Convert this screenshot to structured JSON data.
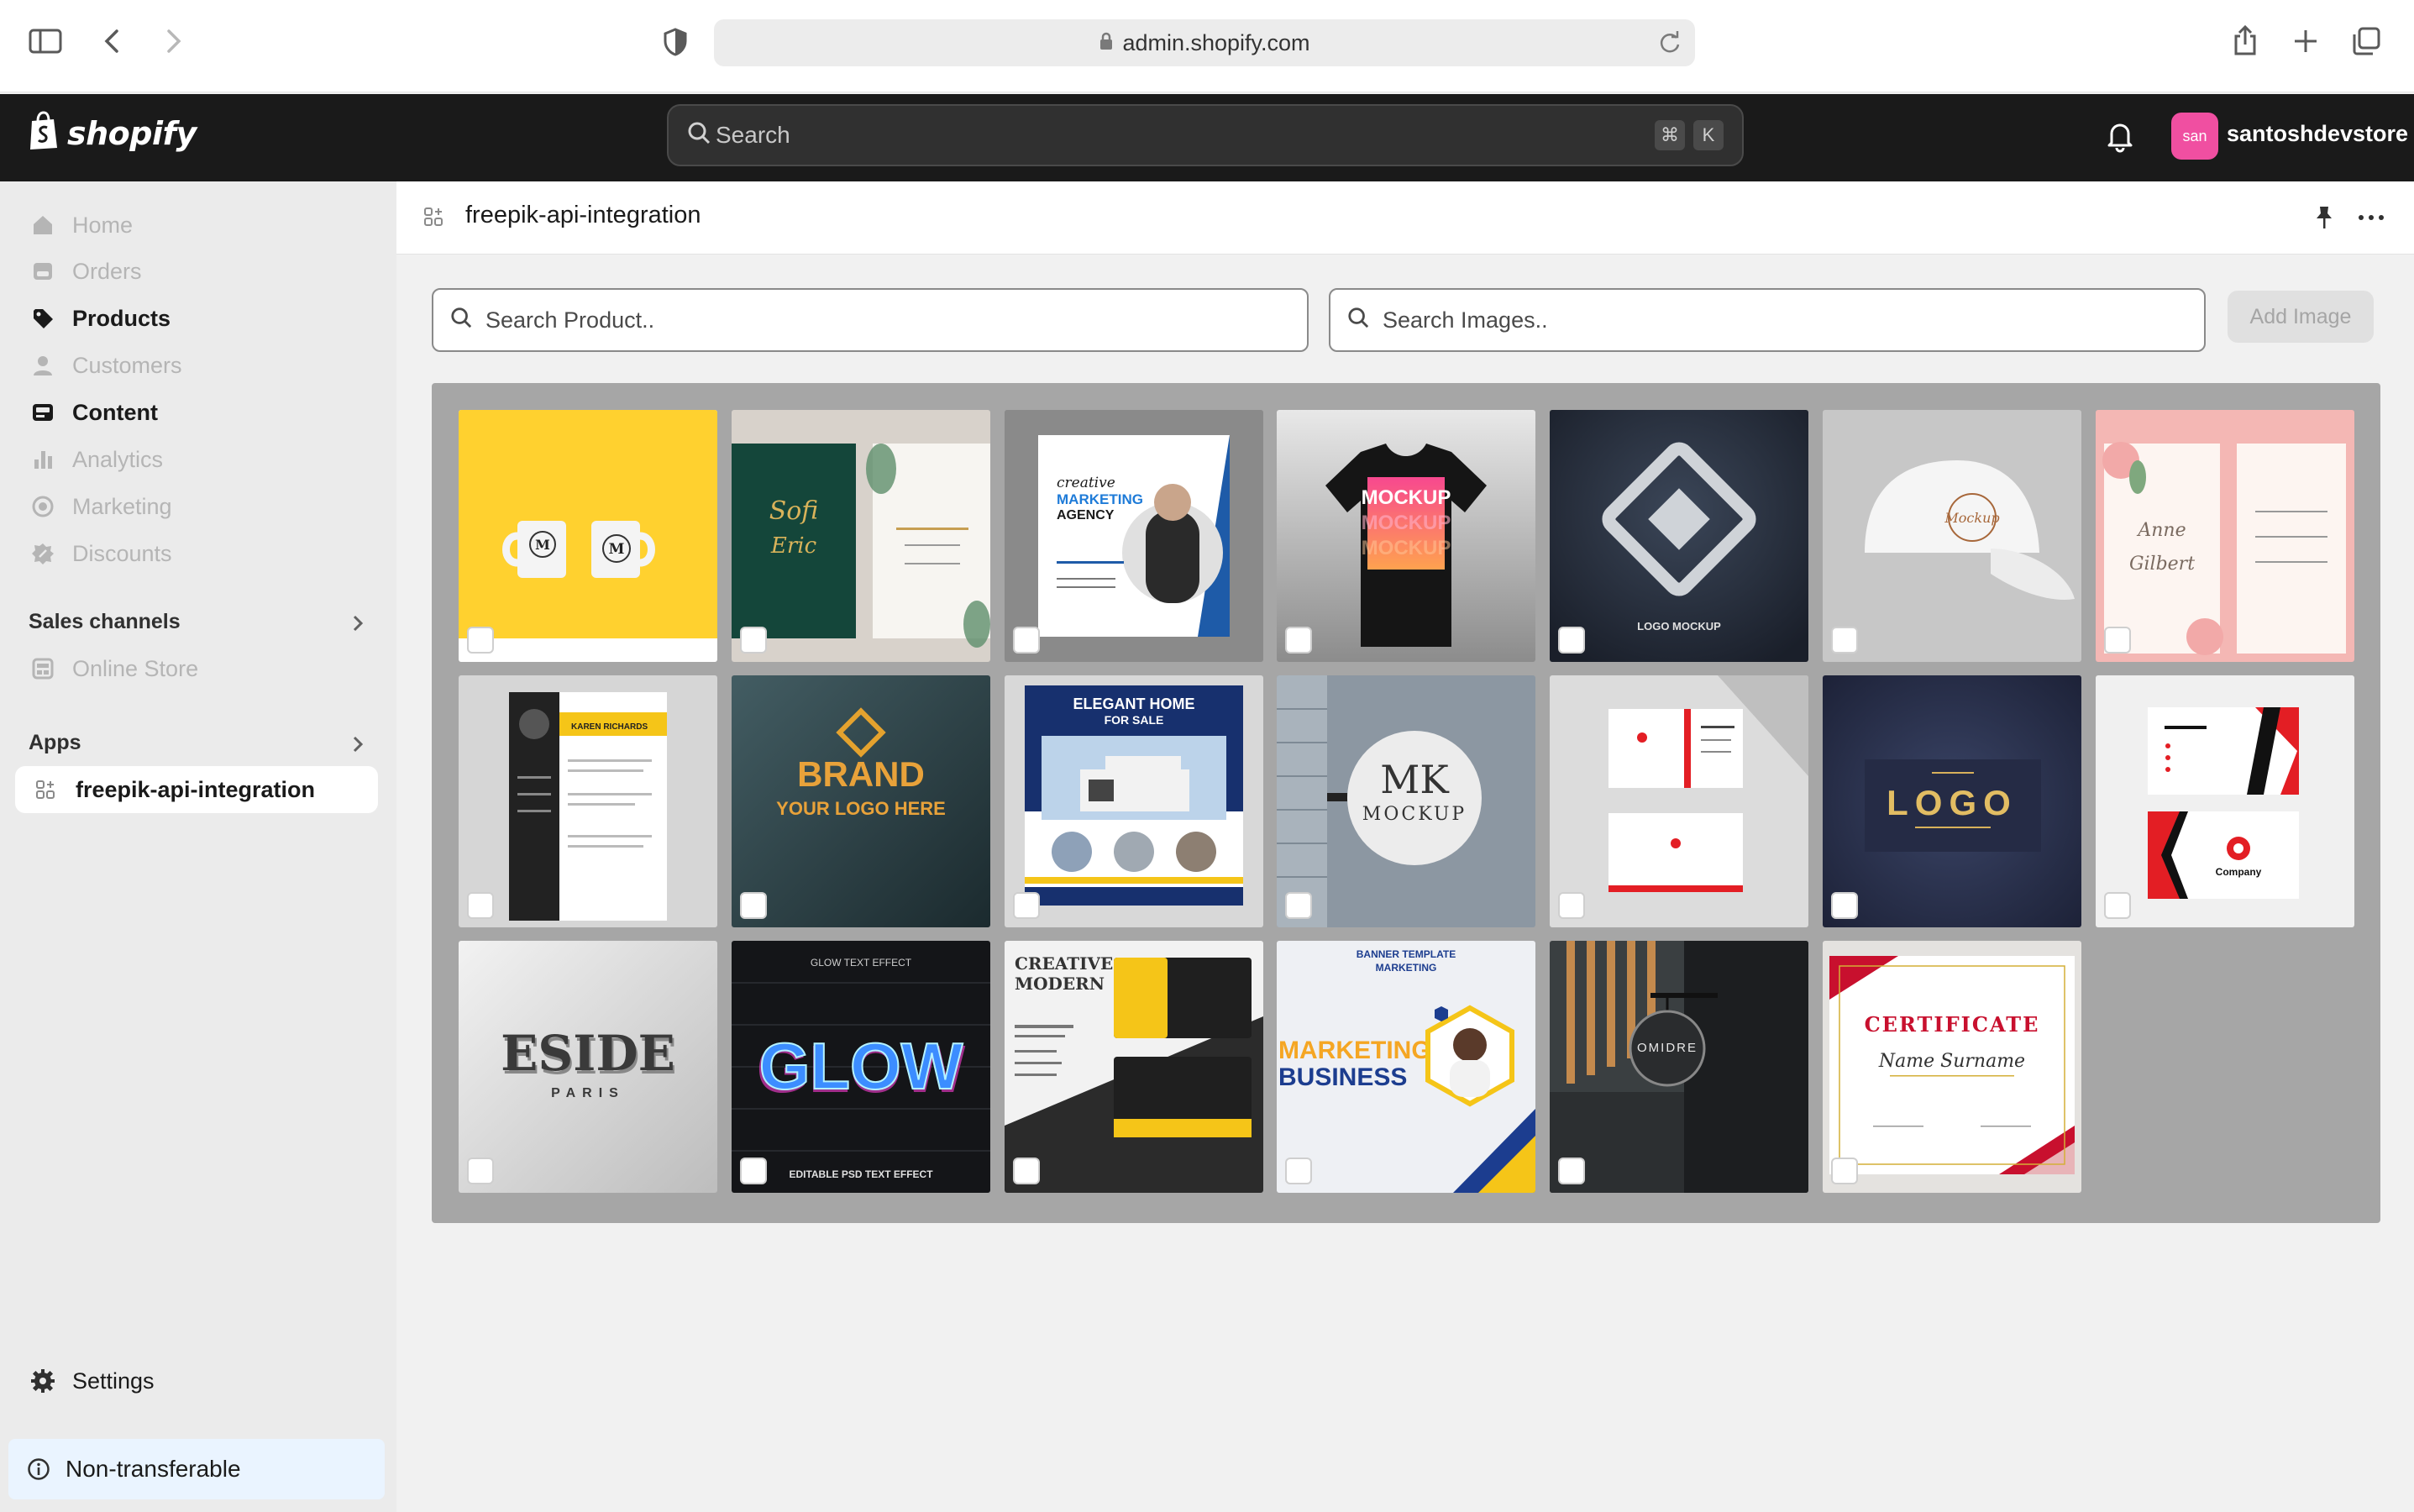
{
  "browser": {
    "url": "admin.shopify.com"
  },
  "topbar": {
    "logo_text": "shopify",
    "search_placeholder": "Search",
    "shortcut_keys": [
      "⌘",
      "K"
    ],
    "avatar_initials": "san",
    "store_name": "santoshdevstore"
  },
  "sidebar": {
    "items": [
      {
        "label": "Home",
        "icon": "home-icon",
        "active": false
      },
      {
        "label": "Orders",
        "icon": "orders-icon",
        "active": false
      },
      {
        "label": "Products",
        "icon": "tag-icon",
        "active": true
      },
      {
        "label": "Customers",
        "icon": "person-icon",
        "active": false
      },
      {
        "label": "Content",
        "icon": "content-icon",
        "active": true
      },
      {
        "label": "Analytics",
        "icon": "bar-chart-icon",
        "active": false
      },
      {
        "label": "Marketing",
        "icon": "target-icon",
        "active": false
      },
      {
        "label": "Discounts",
        "icon": "discount-icon",
        "active": false
      }
    ],
    "sales_channels_label": "Sales channels",
    "online_store_label": "Online Store",
    "apps_label": "Apps",
    "app_item_label": "freepik-api-integration",
    "settings_label": "Settings",
    "non_transferable_label": "Non-transferable"
  },
  "page": {
    "title": "freepik-api-integration",
    "search_product_placeholder": "Search Product..",
    "search_images_placeholder": "Search Images..",
    "add_image_label": "Add Image"
  },
  "gallery": {
    "images": [
      {
        "id": "mugs",
        "text": []
      },
      {
        "id": "wedding-green",
        "text": []
      },
      {
        "id": "marketing-agency",
        "text": [
          "creative",
          "MARKETING",
          "AGENCY"
        ]
      },
      {
        "id": "tshirt",
        "text": [
          "MOCKUP"
        ]
      },
      {
        "id": "logo-silver",
        "text": [
          "LOGO MOCKUP"
        ]
      },
      {
        "id": "cap",
        "text": [
          "Mockup"
        ]
      },
      {
        "id": "wedding-pink",
        "text": []
      },
      {
        "id": "resume",
        "text": [
          "KAREN RICHARDS"
        ]
      },
      {
        "id": "brand-gold",
        "text": [
          "BRAND",
          "YOUR LOGO HERE"
        ]
      },
      {
        "id": "elegant-home",
        "text": [
          "ELEGANT HOME",
          "FOR SALE"
        ]
      },
      {
        "id": "mk-sign",
        "text": [
          "MK",
          "MOCKUP"
        ]
      },
      {
        "id": "business-card-red",
        "text": []
      },
      {
        "id": "logo-navy",
        "text": [
          "LOGO"
        ]
      },
      {
        "id": "company-card",
        "text": [
          "Company"
        ]
      },
      {
        "id": "eside",
        "text": [
          "ESIDE",
          "PARIS"
        ]
      },
      {
        "id": "glow",
        "text": [
          "GLOW TEXT EFFECT",
          "GLOW",
          "EDITABLE PSD TEXT EFFECT"
        ]
      },
      {
        "id": "creative-modern",
        "text": [
          "CREATIVE",
          "MODERN"
        ]
      },
      {
        "id": "banner-marketing",
        "text": [
          "BANNER TEMPLATE",
          "MARKETING",
          "MARKETING",
          "BUSINESS"
        ]
      },
      {
        "id": "omidre",
        "text": [
          "OMIDRE"
        ]
      },
      {
        "id": "certificate",
        "text": [
          "CERTIFICATE",
          "Name Surname"
        ]
      }
    ]
  }
}
